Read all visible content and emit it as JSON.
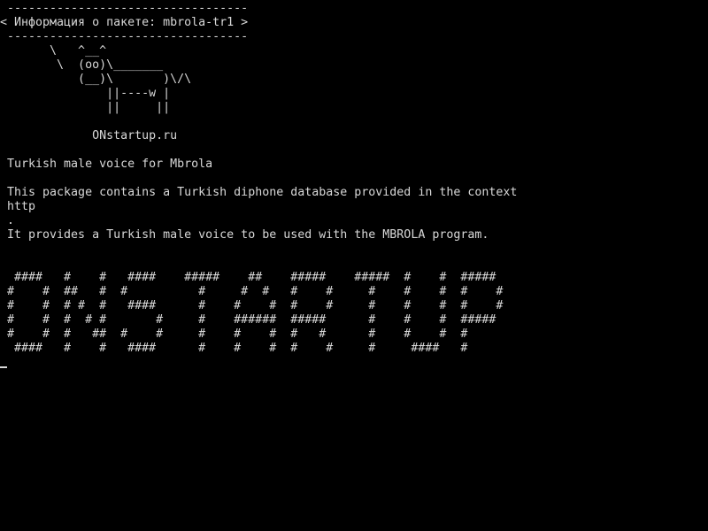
{
  "terminal": {
    "lines": [
      " ----------------------------------",
      "< Информация о пакете: mbrola-tr1 >",
      " ----------------------------------",
      "       \\   ^__^",
      "        \\  (oo)\\_______",
      "           (__)\\       )\\/\\",
      "               ||----w |",
      "               ||     ||",
      "",
      "             ONstartup.ru",
      "",
      " Turkish male voice for Mbrola",
      "",
      " This package contains a Turkish diphone database provided in the context",
      " http",
      " .",
      " It provides a Turkish male voice to be used with the MBROLA program.",
      "",
      "",
      "  ####   #    #   ####    #####    ##    #####    #####  #    #  #####",
      " #    #  ##   #  #          #     #  #   #    #     #    #    #  #    #",
      " #    #  # #  #   ####      #    #    #  #    #     #    #    #  #    #",
      " #    #  #  # #       #     #    ######  #####      #    #    #  #####",
      " #    #  #   ##  #    #     #    #    #  #   #      #    #    #  #",
      "  ####   #    #   ####      #    #    #  #    #     #     ####   #"
    ],
    "colors": {
      "background": "#000000",
      "foreground": "#d8d8d8"
    }
  }
}
